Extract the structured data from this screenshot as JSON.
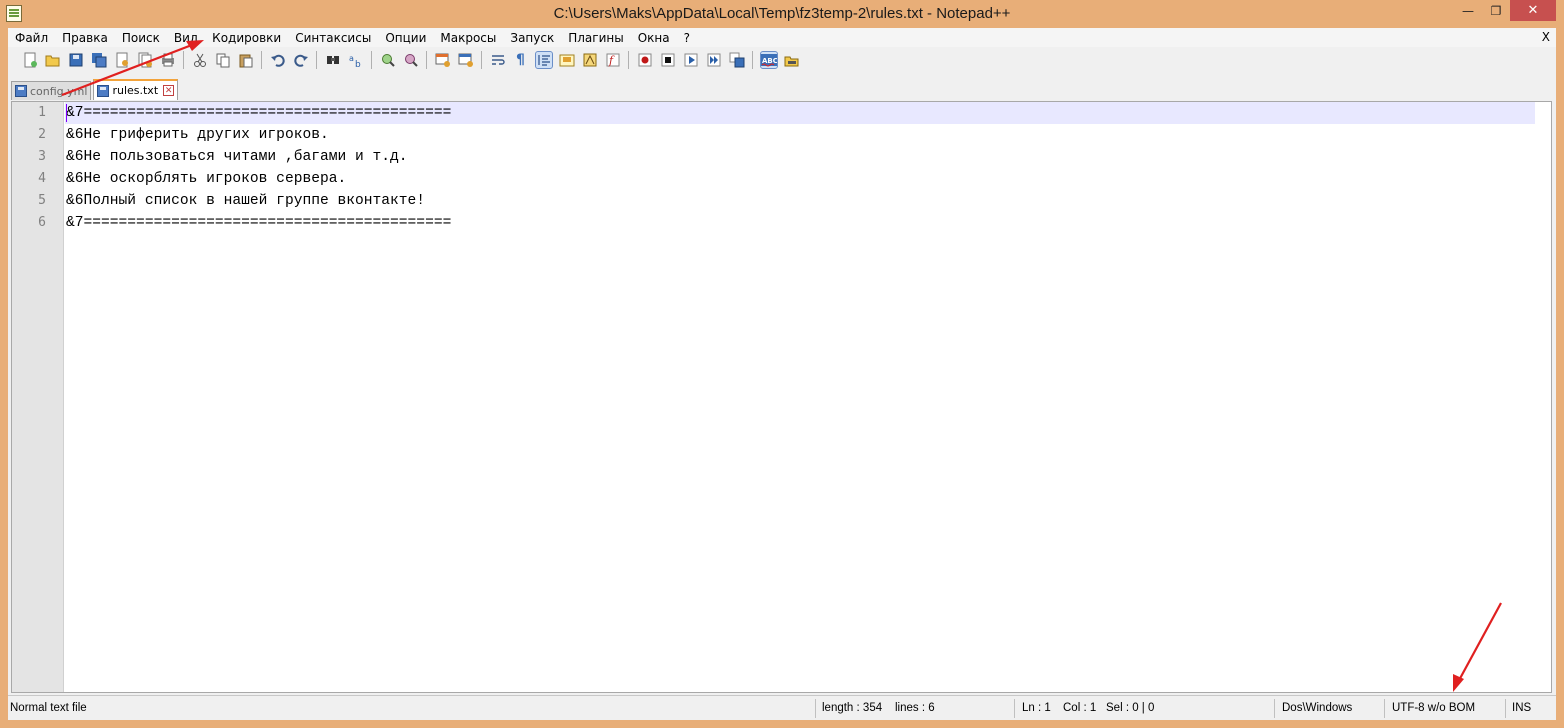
{
  "window": {
    "title": "C:\\Users\\Maks\\AppData\\Local\\Temp\\fz3temp-2\\rules.txt - Notepad++",
    "min_label": "—",
    "max_label": "❐",
    "close_label": "✕"
  },
  "menu": {
    "items": [
      "Файл",
      "Правка",
      "Поиск",
      "Вид",
      "Кодировки",
      "Синтаксисы",
      "Опции",
      "Макросы",
      "Запуск",
      "Плагины",
      "Окна",
      "?"
    ],
    "close_label": "X"
  },
  "toolbar": {
    "icons": [
      "new-file-icon",
      "open-file-icon",
      "save-icon",
      "save-all-icon",
      "close-icon",
      "close-all-icon",
      "print-icon",
      "cut-icon",
      "copy-icon",
      "paste-icon",
      "undo-icon",
      "redo-icon",
      "find-icon",
      "replace-icon",
      "zoom-in-icon",
      "zoom-out-icon",
      "sync-vertical-icon",
      "sync-horizontal-icon",
      "word-wrap-icon",
      "show-all-chars-icon",
      "indent-guide-icon",
      "user-defined-lang-icon",
      "doc-map-icon",
      "function-list-icon",
      "record-macro-icon",
      "stop-record-icon",
      "play-macro-icon",
      "run-macro-multiple-icon",
      "save-macro-icon",
      "spell-check-icon",
      "plugin-icon"
    ]
  },
  "tabs": [
    {
      "label": "config.yml",
      "active": false
    },
    {
      "label": "rules.txt",
      "active": true
    }
  ],
  "editor": {
    "line_numbers": [
      "1",
      "2",
      "3",
      "4",
      "5",
      "6"
    ],
    "lines": [
      "&7==========================================",
      "&6Не гриферить других игроков.",
      "&6Не пользоваться читами ,багами и т.д.",
      "&6Не оскорблять игроков сервера.",
      "&6Полный список в нашей группе вконтакте!",
      "&7=========================================="
    ]
  },
  "status": {
    "filetype": "Normal text file",
    "length": "length : 354",
    "lines": "lines : 6",
    "ln": "Ln : 1",
    "col": "Col : 1",
    "sel": "Sel : 0 | 0",
    "eol": "Dos\\Windows",
    "encoding": "UTF-8 w/o BOM",
    "mode": "INS"
  },
  "colors": {
    "annotation_arrow": "#e02020",
    "current_line": "#e8e8ff",
    "tab_accent": "#f3a33a"
  }
}
